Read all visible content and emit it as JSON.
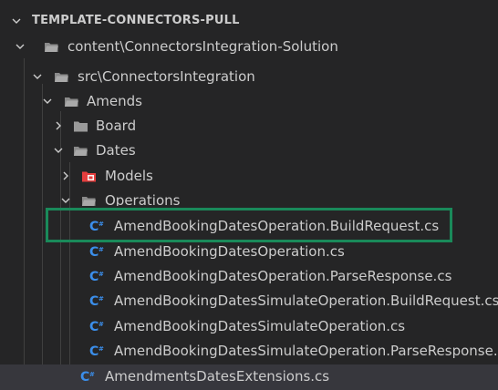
{
  "explorer": {
    "section_title": "TEMPLATE-CONNECTORS-PULL",
    "tree": [
      {
        "label": "content\\ConnectorsIntegration-Solution",
        "kind": "folder",
        "expanded": true,
        "icon": "folder-open-icon"
      },
      {
        "label": "src\\ConnectorsIntegration",
        "kind": "folder",
        "expanded": true,
        "icon": "folder-open-icon"
      },
      {
        "label": "Amends",
        "kind": "folder",
        "expanded": true,
        "icon": "folder-open-icon"
      },
      {
        "label": "Board",
        "kind": "folder",
        "expanded": false,
        "icon": "folder-closed-icon"
      },
      {
        "label": "Dates",
        "kind": "folder",
        "expanded": true,
        "icon": "folder-open-icon"
      },
      {
        "label": "Models",
        "kind": "folder",
        "expanded": false,
        "icon": "models-folder-icon"
      },
      {
        "label": "Operations",
        "kind": "folder",
        "expanded": true,
        "icon": "folder-open-icon"
      },
      {
        "label": "AmendBookingDatesOperation.BuildRequest.cs",
        "kind": "file",
        "icon": "csharp-file-icon"
      },
      {
        "label": "AmendBookingDatesOperation.cs",
        "kind": "file",
        "icon": "csharp-file-icon"
      },
      {
        "label": "AmendBookingDatesOperation.ParseResponse.cs",
        "kind": "file",
        "icon": "csharp-file-icon"
      },
      {
        "label": "AmendBookingDatesSimulateOperation.BuildRequest.cs",
        "kind": "file",
        "icon": "csharp-file-icon"
      },
      {
        "label": "AmendBookingDatesSimulateOperation.cs",
        "kind": "file",
        "icon": "csharp-file-icon"
      },
      {
        "label": "AmendBookingDatesSimulateOperation.ParseResponse.cs",
        "kind": "file",
        "icon": "csharp-file-icon"
      },
      {
        "label": "AmendmentsDatesExtensions.cs",
        "kind": "file",
        "selected": true,
        "icon": "csharp-file-icon"
      }
    ]
  },
  "colors": {
    "background": "#252526",
    "text": "#cccccc",
    "folder": "#c09553",
    "models_folder": "#e53e3e",
    "csharp": "#3b8eea",
    "selection": "#37373d",
    "annotation_box": "#1a8a5a"
  }
}
